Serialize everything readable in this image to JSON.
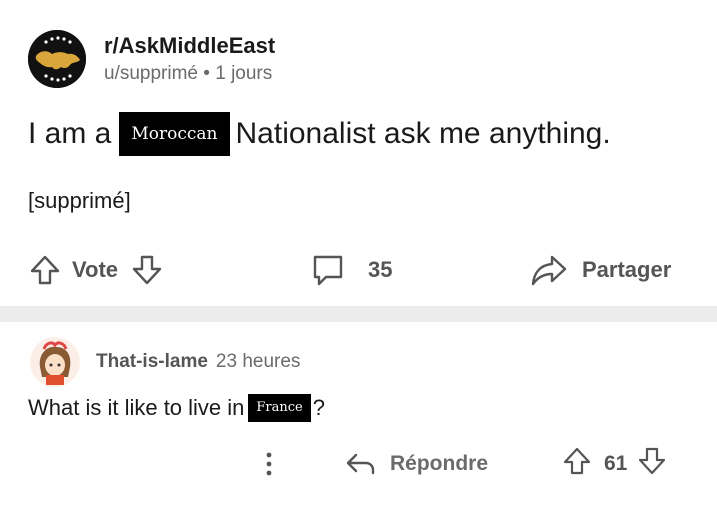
{
  "post": {
    "subreddit": "r/AskMiddleEast",
    "author": "u/supprimé",
    "separator": "•",
    "age": "1 jours",
    "title_before": "I am a",
    "title_redacted": "Moroccan",
    "title_after": "Nationalist ask me anything.",
    "body": "[supprimé]",
    "actions": {
      "vote_label": "Vote",
      "comment_count": "35",
      "share_label": "Partager"
    }
  },
  "comment": {
    "username": "That-is-lame",
    "age": "23 heures",
    "text_before": "What is it like to live in",
    "text_redacted": "France",
    "text_after": "?",
    "actions": {
      "reply_label": "Répondre",
      "vote_count": "61"
    }
  },
  "colors": {
    "text": "#1a1a1b",
    "muted": "#6b6b6b",
    "icon": "#555555",
    "divider": "#ececec",
    "redaction": "#000000"
  },
  "icons": {
    "subreddit_avatar": "middle-east-map-icon",
    "upvote": "arrow-up-outline-icon",
    "downvote": "arrow-down-outline-icon",
    "comment": "speech-bubble-icon",
    "share": "share-arrow-icon",
    "more": "vertical-dots-icon",
    "reply": "reply-arrow-icon"
  }
}
